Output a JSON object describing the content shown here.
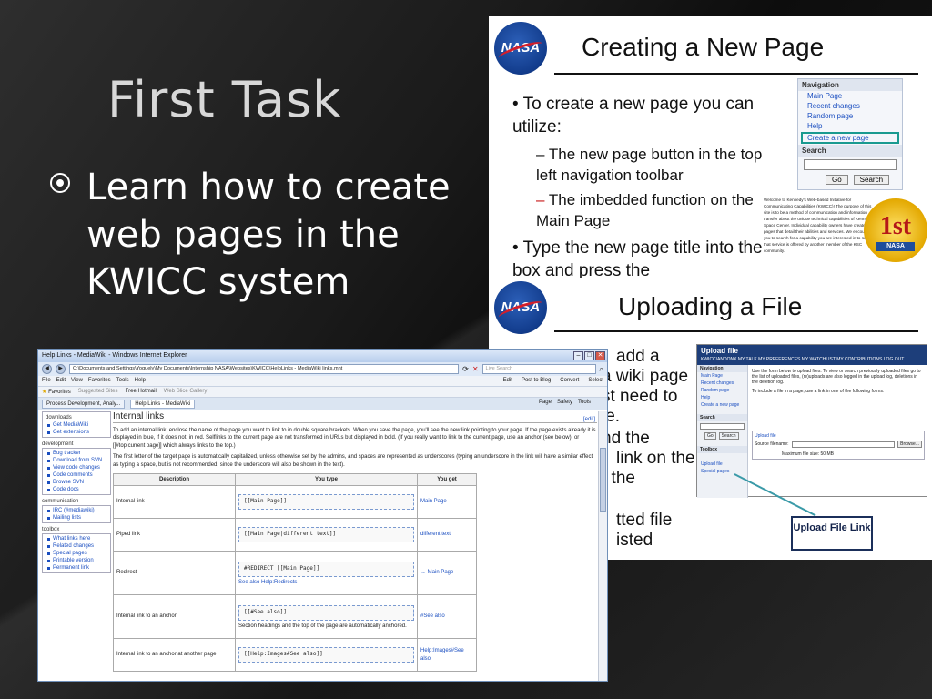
{
  "slide": {
    "title": "First Task",
    "bullet": "Learn how to create web pages in the KWICC system"
  },
  "image1": {
    "logo": "NASA",
    "title": "Creating a New Page",
    "bullet1": "To create a new page you can utilize:",
    "sub1": "The new page button in the top left navigation toolbar",
    "sub2": "The imbedded function on the Main Page",
    "bullet2": "Type the new page title into the box and press the",
    "nav_head": "Navigation",
    "nav_items": [
      "Main Page",
      "Recent changes",
      "Random page",
      "Help",
      "Create a new page"
    ],
    "search_head": "Search",
    "go_label": "Go",
    "search_label": "Search",
    "kennedy_text": "Welcome to Kennedy's Web-based Initiative for Communicating Capabilities (KWICC)! The purpose of this site is to be a method of communication and information transfer about the unique technical capabilities of Kennedy Space Center. Individual capability owners have created pages that detail their abilities and services. We encourage you to search for a capability you are interested in to see if that service is offered by another member of the KSC community.",
    "badge": "1st"
  },
  "image2": {
    "logo": "NASA",
    "title": "Uploading a File",
    "partial_lines": [
      "add a",
      "a wiki page",
      "st need to",
      "le.",
      "nd the",
      "link on the",
      "f the",
      "tted file",
      "isted"
    ],
    "upload_title": "Upload file",
    "upload_links": "KWICC/ANDONX   MY TALK   MY PREFERENCES   MY WATCHLIST   MY CONTRIBUTIONS   LOG OUT",
    "side_items": [
      "Main Page",
      "Recent changes",
      "Random page",
      "Help",
      "Create a new page"
    ],
    "side_search": "Search",
    "side_go": "Go",
    "side_searchbtn": "Search",
    "side_toolbox": "Toolbox",
    "side_upload": "Upload file",
    "side_special": "Special pages",
    "upload_desc": "Use the form below to upload files. To view or search previously uploaded files go to the list of uploaded files, (re)uploads are also logged in the upload log, deletions in the deletion log.",
    "upload_forms": "To include a file in a page, use a link in one of the following forms:",
    "upload_file_label": "Upload file",
    "source_label": "Source filename:",
    "browse_label": "Browse...",
    "maxsize": "Maximum file size: 50 MB",
    "callout": "Upload File Link"
  },
  "browser": {
    "title": "Help:Links - MediaWiki - Windows Internet Explorer",
    "url": "C:\\Documents and Settings\\Yoguely\\My Documents\\Internship NASA\\Websites\\KWICC\\HelpLinks - MediaWiki links.mht",
    "search_placeholder": "Live Search",
    "menu": [
      "File",
      "Edit",
      "View",
      "Favorites",
      "Tools",
      "Help"
    ],
    "menu_right": [
      "Edit",
      "Post to Blog",
      "Convert",
      "Select"
    ],
    "fav": [
      "Favorites",
      "Suggested Sites",
      "Free Hotmail",
      "Web Slice Gallery"
    ],
    "tabs": [
      "Process Development, Analy...",
      "Help:Links - MediaWiki"
    ],
    "tab_right": [
      "Page",
      "Safety",
      "Tools"
    ],
    "side_top": "downloads",
    "side_downloads": [
      "Get MediaWiki",
      "Get extensions"
    ],
    "side_dev_head": "development",
    "side_dev": [
      "Bug tracker",
      "Download from SVN",
      "View code changes",
      "Code comments",
      "Browse SVN",
      "Code docs"
    ],
    "side_comm_head": "communication",
    "side_comm": [
      "IRC (#mediawiki)",
      "Mailing lists"
    ],
    "side_tool_head": "toolbox",
    "side_tool": [
      "What links here",
      "Related changes",
      "Special pages",
      "Printable version",
      "Permanent link"
    ],
    "heading": "Internal links",
    "edit": "[edit]",
    "para1": "To add an internal link, enclose the name of the page you want to link to in double square brackets. When you save the page, you'll see the new link pointing to your page. If the page exists already it is displayed in blue, if it does not, in red. Selflinks to the current page are not transformed in URLs but displayed in bold. (If you really want to link to the current page, use an anchor (see below), or [[#top|current page]] which always links to the top.)",
    "para2": "The first letter of the target page is automatically capitalized, unless otherwise set by the admins, and spaces are represented as underscores (typing an underscore in the link will have a similar effect as typing a space, but is not recommended, since the underscore will also be shown in the text).",
    "th": [
      "Description",
      "You type",
      "You get"
    ],
    "rows": [
      {
        "desc": "Internal link",
        "type": "[[Main Page]]",
        "note": "",
        "get": "Main Page"
      },
      {
        "desc": "Piped link",
        "type": "[[Main Page|different text]]",
        "note": "",
        "get": "different text"
      },
      {
        "desc": "Redirect",
        "type": "#REDIRECT [[Main Page]]",
        "note": "See also Help:Redirects",
        "get": "→ Main Page"
      },
      {
        "desc": "Internal link to an anchor",
        "type": "[[#See also]]",
        "note": "Section headings and the top of the page are automatically anchored.",
        "get": "#See also"
      },
      {
        "desc": "Internal link to an anchor at another page",
        "type": "[[Help:Images#See also]]",
        "note": "",
        "get": "Help:Images#See also"
      }
    ]
  }
}
